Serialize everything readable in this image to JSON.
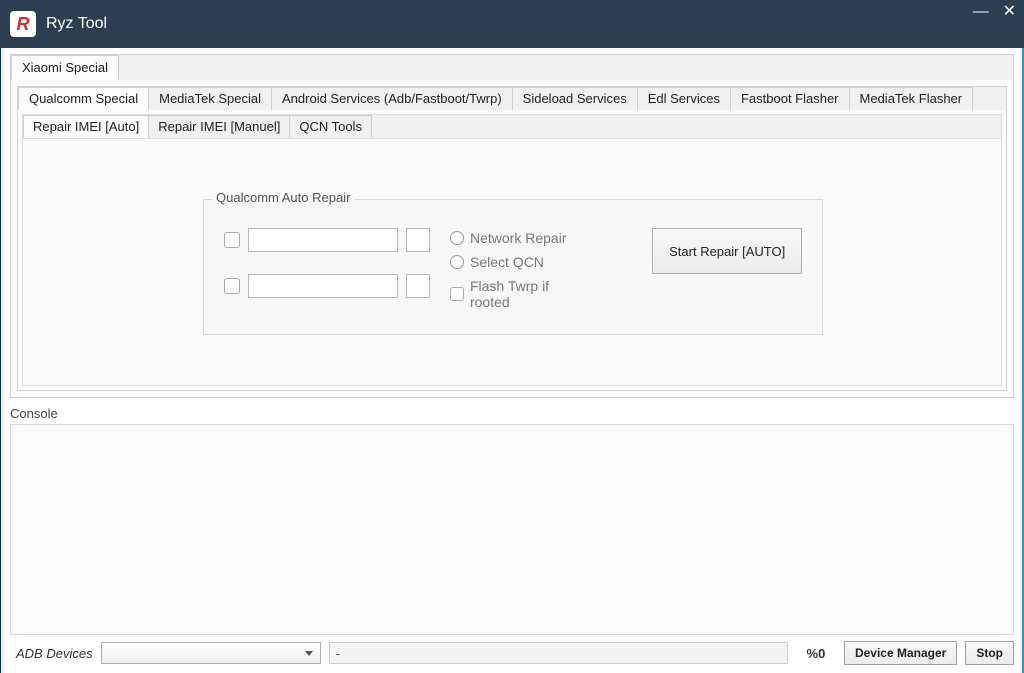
{
  "app": {
    "title": "Ryz Tool",
    "icon_letter": "R"
  },
  "tabs": {
    "outer": [
      {
        "label": "Xiaomi Special",
        "active": true
      }
    ],
    "inner": [
      {
        "label": "Qualcomm Special",
        "active": true
      },
      {
        "label": "MediaTek Special"
      },
      {
        "label": "Android Services (Adb/Fastboot/Twrp)"
      },
      {
        "label": "Sideload Services"
      },
      {
        "label": "Edl Services"
      },
      {
        "label": "Fastboot Flasher"
      },
      {
        "label": "MediaTek Flasher"
      }
    ],
    "sub": [
      {
        "label": "Repair IMEI [Auto]",
        "active": true
      },
      {
        "label": "Repair IMEI [Manuel]"
      },
      {
        "label": "QCN Tools"
      }
    ]
  },
  "group": {
    "title": "Qualcomm Auto Repair",
    "options": {
      "network_repair": "Network Repair",
      "select_qcn": "Select QCN",
      "flash_twrp": "Flash Twrp if rooted"
    },
    "start_button": "Start Repair [AUTO]"
  },
  "console": {
    "label": "Console"
  },
  "bottom": {
    "adb_label": "ADB Devices",
    "progress_text": "-",
    "pct": "%0",
    "device_manager": "Device Manager",
    "stop": "Stop"
  }
}
